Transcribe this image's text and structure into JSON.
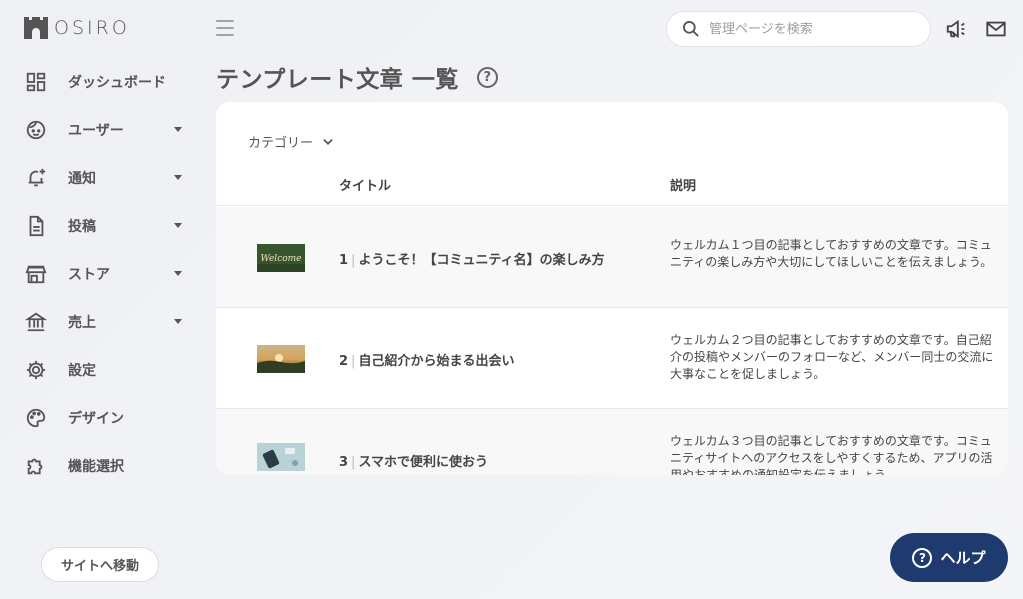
{
  "app": {
    "brand": "OSIRO"
  },
  "header": {
    "search_placeholder": "管理ページを検索",
    "announce_icon": "megaphone-icon",
    "mail_icon": "mail-icon"
  },
  "sidebar": {
    "items": [
      {
        "label": "ダッシュボード",
        "icon": "dashboard-icon",
        "has_submenu": false
      },
      {
        "label": "ユーザー",
        "icon": "user-face-icon",
        "has_submenu": true
      },
      {
        "label": "通知",
        "icon": "bell-add-icon",
        "has_submenu": true
      },
      {
        "label": "投稿",
        "icon": "document-icon",
        "has_submenu": true
      },
      {
        "label": "ストア",
        "icon": "store-icon",
        "has_submenu": true
      },
      {
        "label": "売上",
        "icon": "bank-icon",
        "has_submenu": true
      },
      {
        "label": "設定",
        "icon": "gear-icon",
        "has_submenu": false
      },
      {
        "label": "デザイン",
        "icon": "palette-icon",
        "has_submenu": false
      },
      {
        "label": "機能選択",
        "icon": "puzzle-icon",
        "has_submenu": false
      }
    ],
    "site_button": "サイトへ移動"
  },
  "page": {
    "title": "テンプレート文章 一覧",
    "help_icon": "?"
  },
  "table": {
    "filter_label": "カテゴリー",
    "columns": {
      "title": "タイトル",
      "description": "説明"
    },
    "rows": [
      {
        "number": "1",
        "title": "ようこそ！【コミュニティ名】の楽しみ方",
        "description": "ウェルカム１つ目の記事としておすすめの文章です。コミュニティの楽しみ方や大切にしてほしいことを伝えましょう。",
        "thumbnail_text": "Welcome"
      },
      {
        "number": "2",
        "title": "自己紹介から始まる出会い",
        "description": "ウェルカム２つ目の記事としておすすめの文章です。自己紹介の投稿やメンバーのフォローなど、メンバー同士の交流に大事なことを促しましょう。"
      },
      {
        "number": "3",
        "title": "スマホで便利に使おう",
        "description": "ウェルカム３つ目の記事としておすすめの文章です。コミュニティサイトへのアクセスをしやすくするため、アプリの活用やおすすめの通知設定を伝えましょう。"
      }
    ]
  },
  "help_button": {
    "label": "ヘルプ",
    "icon": "?"
  }
}
